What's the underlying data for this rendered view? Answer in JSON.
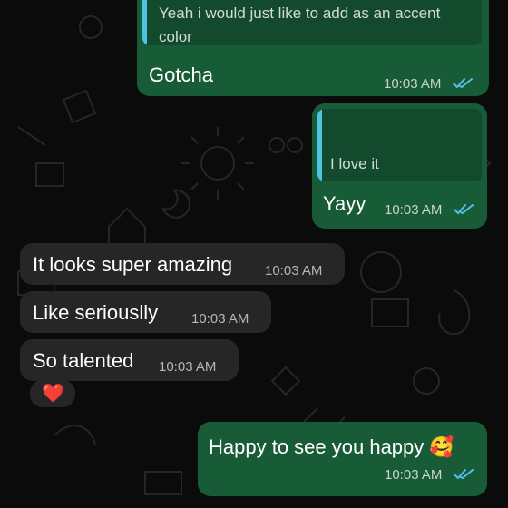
{
  "chat": {
    "messages": [
      {
        "direction": "out",
        "quote": "Yeah i would just like to add as an accent color",
        "text": "Gotcha",
        "time": "10:03 AM",
        "status": "read"
      },
      {
        "direction": "out",
        "quote": "I love it",
        "text": "Yayy",
        "time": "10:03 AM",
        "status": "read"
      },
      {
        "direction": "in",
        "text": "It looks super amazing",
        "time": "10:03 AM"
      },
      {
        "direction": "in",
        "text": "Like seriouslly",
        "time": "10:03 AM"
      },
      {
        "direction": "in",
        "text": "So talented",
        "time": "10:03 AM"
      },
      {
        "direction": "in",
        "text": "❤️"
      },
      {
        "direction": "out",
        "text": "Happy to see you happy 🥰",
        "time": "10:03 AM",
        "status": "read"
      }
    ]
  },
  "colors": {
    "background": "#0b0b0b",
    "outgoing_bubble": "#185c37",
    "incoming_bubble": "#262626",
    "quote_bar": "#4fc3e6",
    "read_ticks": "#53bdeb"
  },
  "icons": {
    "read_receipt": "double-check-icon",
    "heart": "red-heart-emoji",
    "smile": "smiling-face-with-hearts-emoji"
  }
}
